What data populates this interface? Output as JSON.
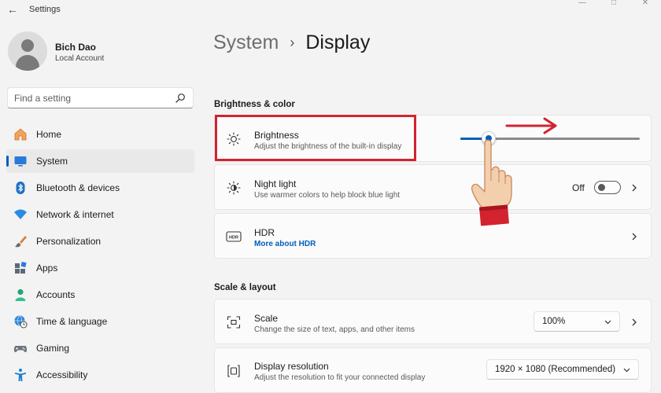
{
  "window": {
    "back_glyph": "←",
    "title": "Settings",
    "controls": [
      "—",
      "□",
      "✕"
    ]
  },
  "profile": {
    "name": "Bich Dao",
    "account_type": "Local Account"
  },
  "search": {
    "placeholder": "Find a setting",
    "value": ""
  },
  "nav": {
    "items": [
      {
        "label": "Home",
        "icon": "home-icon",
        "active": false
      },
      {
        "label": "System",
        "icon": "system-icon",
        "active": true
      },
      {
        "label": "Bluetooth & devices",
        "icon": "bluetooth-icon",
        "active": false
      },
      {
        "label": "Network & internet",
        "icon": "wifi-icon",
        "active": false
      },
      {
        "label": "Personalization",
        "icon": "brush-icon",
        "active": false
      },
      {
        "label": "Apps",
        "icon": "apps-icon",
        "active": false
      },
      {
        "label": "Accounts",
        "icon": "person-icon",
        "active": false
      },
      {
        "label": "Time & language",
        "icon": "globe-clock-icon",
        "active": false
      },
      {
        "label": "Gaming",
        "icon": "gamepad-icon",
        "active": false
      },
      {
        "label": "Accessibility",
        "icon": "accessibility-icon",
        "active": false
      }
    ]
  },
  "breadcrumb": {
    "parent": "System",
    "separator": "›",
    "current": "Display"
  },
  "sections": {
    "brightness_color": "Brightness & color",
    "scale_layout": "Scale & layout"
  },
  "brightness": {
    "title": "Brightness",
    "subtitle": "Adjust the brightness of the built-in display",
    "level_percent": 16
  },
  "night_light": {
    "title": "Night light",
    "subtitle": "Use warmer colors to help block blue light",
    "state_label": "Off"
  },
  "hdr": {
    "title": "HDR",
    "link": "More about HDR"
  },
  "scale": {
    "title": "Scale",
    "subtitle": "Change the size of text, apps, and other items",
    "value": "100%"
  },
  "resolution": {
    "title": "Display resolution",
    "subtitle": "Adjust the resolution to fit your connected display",
    "value": "1920 × 1080 (Recommended)"
  },
  "colors": {
    "accent": "#005fb8",
    "annotation": "#d3232f"
  }
}
